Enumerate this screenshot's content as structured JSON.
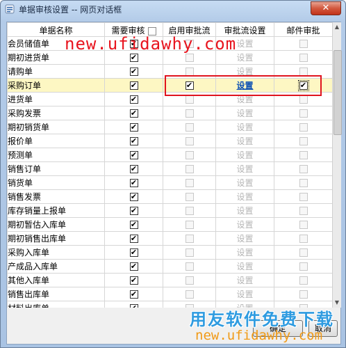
{
  "window": {
    "title": "单据审核设置 -- 网页对话框",
    "close_label": "✕"
  },
  "columns": [
    "单据名称",
    "需要审核",
    "启用审批流",
    "审批流设置",
    "邮件审批"
  ],
  "rows": [
    {
      "name": "会员储值单",
      "need": true,
      "flow": false,
      "setting": "设置",
      "mail": false
    },
    {
      "name": "期初进货单",
      "need": true,
      "flow": false,
      "setting": "设置",
      "mail": false
    },
    {
      "name": "请购单",
      "need": true,
      "flow": false,
      "setting": "设置",
      "mail": false
    },
    {
      "name": "采购订单",
      "need": true,
      "flow": true,
      "setting": "设置",
      "mail": true,
      "selected": true
    },
    {
      "name": "进货单",
      "need": true,
      "flow": false,
      "setting": "设置",
      "mail": false
    },
    {
      "name": "采购发票",
      "need": true,
      "flow": false,
      "setting": "设置",
      "mail": false
    },
    {
      "name": "期初销货单",
      "need": true,
      "flow": false,
      "setting": "设置",
      "mail": false
    },
    {
      "name": "报价单",
      "need": true,
      "flow": false,
      "setting": "设置",
      "mail": false
    },
    {
      "name": "预测单",
      "need": true,
      "flow": false,
      "setting": "设置",
      "mail": false
    },
    {
      "name": "销售订单",
      "need": true,
      "flow": false,
      "setting": "设置",
      "mail": false
    },
    {
      "name": "销货单",
      "need": true,
      "flow": false,
      "setting": "设置",
      "mail": false
    },
    {
      "name": "销售发票",
      "need": true,
      "flow": false,
      "setting": "设置",
      "mail": false
    },
    {
      "name": "库存销量上报单",
      "need": true,
      "flow": false,
      "setting": "设置",
      "mail": false
    },
    {
      "name": "期初暂估入库单",
      "need": true,
      "flow": false,
      "setting": "设置",
      "mail": false
    },
    {
      "name": "期初销售出库单",
      "need": true,
      "flow": false,
      "setting": "设置",
      "mail": false
    },
    {
      "name": "采购入库单",
      "need": true,
      "flow": false,
      "setting": "设置",
      "mail": false
    },
    {
      "name": "产成品入库单",
      "need": true,
      "flow": false,
      "setting": "设置",
      "mail": false
    },
    {
      "name": "其他入库单",
      "need": true,
      "flow": false,
      "setting": "设置",
      "mail": false
    },
    {
      "name": "销售出库单",
      "need": true,
      "flow": false,
      "setting": "设置",
      "mail": false
    },
    {
      "name": "材料出库单",
      "need": true,
      "flow": false,
      "setting": "设置",
      "mail": false
    }
  ],
  "buttons": {
    "ok": "确定",
    "cancel": "取消"
  },
  "watermark": {
    "top": "new.ufidawhy.com",
    "bottom_cn": "用友软件免费下载",
    "bottom_url": "new.ufidawhy.com"
  },
  "colors": {
    "highlight_box": "#e0141e",
    "selected_row": "#fdf7c3",
    "watermark_red": "#e8141e",
    "watermark_blue": "#2e9be0"
  }
}
